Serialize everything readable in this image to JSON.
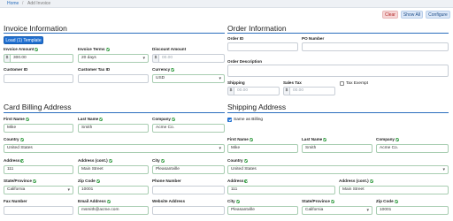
{
  "breadcrumb": {
    "home": "Home",
    "separator": "/",
    "current": "Add Invoice"
  },
  "toolbar": {
    "clear": "Clear",
    "show_all": "Show All",
    "configure": "Configure"
  },
  "invoice_info": {
    "title": "Invoice Information",
    "template_button": "Load (1) Template",
    "invoice_amount": {
      "label": "Invoice Amount",
      "prefix": "$",
      "value": "300.00"
    },
    "invoice_terms": {
      "label": "Invoice Terms",
      "value": "20 days"
    },
    "discount_amount": {
      "label": "Discount Amount",
      "prefix": "$",
      "placeholder": "00.00"
    },
    "customer_id": {
      "label": "Customer ID"
    },
    "customer_tax_id": {
      "label": "Customer Tax ID"
    },
    "currency": {
      "label": "Currency",
      "value": "USD"
    }
  },
  "order_info": {
    "title": "Order Information",
    "order_id": {
      "label": "Order ID"
    },
    "po_number": {
      "label": "PO Number"
    },
    "order_description": {
      "label": "Order Description"
    },
    "shipping": {
      "label": "Shipping",
      "prefix": "$",
      "placeholder": "00.00"
    },
    "sales_tax": {
      "label": "Sales Tax",
      "prefix": "$",
      "placeholder": "00.00"
    },
    "tax_exempt": {
      "label": "Tax Exempt",
      "checked": false
    }
  },
  "billing": {
    "title": "Card Billing Address",
    "first_name": {
      "label": "First Name",
      "value": "Mike"
    },
    "last_name": {
      "label": "Last Name",
      "value": "Smith"
    },
    "company": {
      "label": "Company",
      "value": "Acme Co."
    },
    "country": {
      "label": "Country",
      "value": "United States"
    },
    "address": {
      "label": "Address",
      "value": "111"
    },
    "address_cont": {
      "label": "Address (cont.)",
      "value": "Main Street"
    },
    "city": {
      "label": "City",
      "value": "Pleasantville"
    },
    "state": {
      "label": "State/Province",
      "value": "California"
    },
    "zip": {
      "label": "Zip Code",
      "value": "10001"
    },
    "phone": {
      "label": "Phone Number"
    },
    "fax": {
      "label": "Fax Number"
    },
    "email": {
      "label": "Email Address",
      "value": "msmith@acme.com"
    },
    "website": {
      "label": "Website Address"
    }
  },
  "shipping_addr": {
    "title": "Shipping Address",
    "same_as_billing": {
      "label": "Same as Billing",
      "checked": true
    },
    "first_name": {
      "label": "First Name",
      "value": "Mike"
    },
    "last_name": {
      "label": "Last Name",
      "value": "Smith"
    },
    "company": {
      "label": "Company",
      "value": "Acme Co."
    },
    "country": {
      "label": "Country",
      "value": "United States"
    },
    "address": {
      "label": "Address",
      "value": "111"
    },
    "address_cont": {
      "label": "Address (cont.)",
      "value": "Main Street"
    },
    "city": {
      "label": "City",
      "value": "Pleasantville"
    },
    "state": {
      "label": "State/Province",
      "value": "California"
    },
    "zip": {
      "label": "Zip Code",
      "value": "10001"
    }
  },
  "colors": {
    "accent": "#1f6fd1",
    "valid": "#2f9a3e",
    "rule": "#2a6ebd"
  },
  "icons": {
    "valid": "check-circle-icon",
    "select": "chevron-down-icon"
  }
}
